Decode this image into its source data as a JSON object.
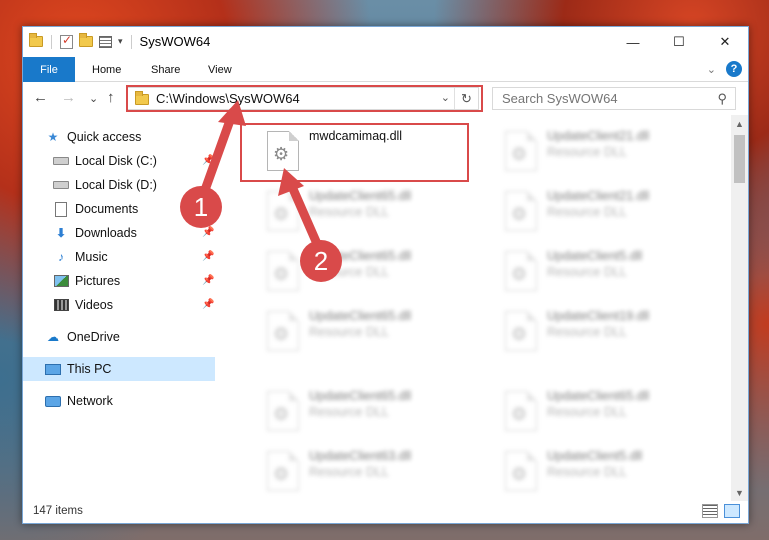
{
  "window": {
    "title": "SysWOW64",
    "controls": {
      "minimize": "—",
      "maximize": "☐",
      "close": "✕"
    }
  },
  "ribbon": {
    "tabs": [
      "File",
      "Home",
      "Share",
      "View"
    ],
    "collapse": "⌄",
    "help": "?"
  },
  "nav": {
    "back": "←",
    "forward": "→",
    "recent": "⌄",
    "up": "↑",
    "address": "C:\\Windows\\SysWOW64",
    "address_dropdown": "⌄",
    "refresh": "↻",
    "search_placeholder": "Search SysWOW64"
  },
  "sidebar": {
    "items": [
      {
        "label": "Quick access",
        "icon": "star-icon"
      },
      {
        "label": "Local Disk (C:)",
        "icon": "disk-icon",
        "pinned": true
      },
      {
        "label": "Local Disk (D:)",
        "icon": "disk-icon"
      },
      {
        "label": "Documents",
        "icon": "documents-icon",
        "pinned": true
      },
      {
        "label": "Downloads",
        "icon": "downloads-icon",
        "pinned": true
      },
      {
        "label": "Music",
        "icon": "music-icon",
        "pinned": true
      },
      {
        "label": "Pictures",
        "icon": "pictures-icon",
        "pinned": true
      },
      {
        "label": "Videos",
        "icon": "videos-icon",
        "pinned": true
      },
      {
        "label": "OneDrive",
        "icon": "onedrive-icon"
      },
      {
        "label": "This PC",
        "icon": "this-pc-icon",
        "selected": true
      },
      {
        "label": "Network",
        "icon": "network-icon"
      }
    ]
  },
  "files": [
    {
      "name": "mwdcamimaq.dll",
      "type": ""
    },
    {
      "name": "UpdateClient21.dll",
      "type": "Resource DLL"
    },
    {
      "name": "UpdateClient65.dll",
      "type": "Resource DLL"
    },
    {
      "name": "UpdateClient21.dll",
      "type": "Resource DLL"
    },
    {
      "name": "UpdateClient65.dll",
      "type": "Resource DLL"
    },
    {
      "name": "UpdateClient5.dll",
      "type": "Resource DLL"
    },
    {
      "name": "UpdateClient65.dll",
      "type": "Resource DLL"
    },
    {
      "name": "UpdateClient19.dll",
      "type": "Resource DLL"
    },
    {
      "name": "UpdateClient65.dll",
      "type": "Resource DLL"
    },
    {
      "name": "UpdateClient65.dll",
      "type": "Resource DLL"
    },
    {
      "name": "UpdateClient63.dll",
      "type": "Resource DLL"
    },
    {
      "name": "UpdateClient5.dll",
      "type": "Resource DLL"
    }
  ],
  "status": {
    "item_count": "147 items"
  },
  "annotations": {
    "badge_1": "1",
    "badge_2": "2",
    "color": "#d94a4a"
  },
  "colors": {
    "accent": "#1979ca",
    "selection": "#cde8ff",
    "highlight_box": "#d94a4a"
  }
}
